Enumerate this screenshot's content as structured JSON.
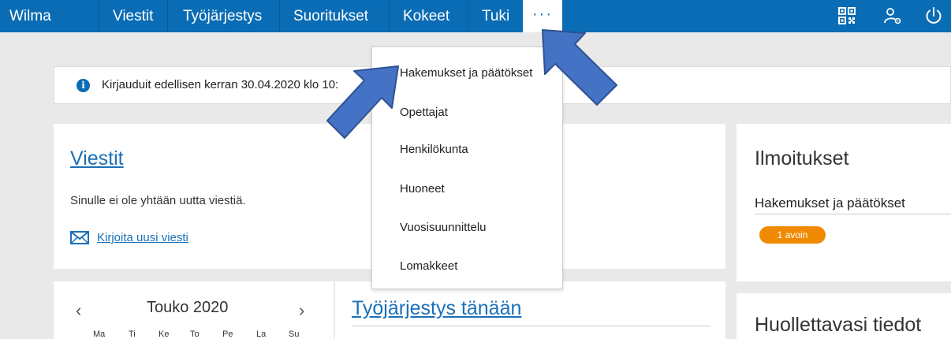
{
  "nav": {
    "brand": "Wilma",
    "items": [
      {
        "label": "Viestit"
      },
      {
        "label": "Työjärjestys"
      },
      {
        "label": "Suoritukset"
      },
      {
        "label": "Kokeet"
      },
      {
        "label": "Tuki"
      }
    ],
    "more_label": "···",
    "icons": [
      "qr-code-icon",
      "user-settings-icon",
      "power-icon"
    ]
  },
  "notice": {
    "text": "Kirjauduit edellisen kerran 30.04.2020 klo 10:"
  },
  "dropdown": {
    "items": [
      {
        "label": "Hakemukset ja päätökset"
      },
      {
        "label": "Opettajat"
      },
      {
        "label": "Henkilökunta"
      },
      {
        "label": "Huoneet"
      },
      {
        "label": "Vuosisuunnittelu"
      },
      {
        "label": "Lomakkeet"
      }
    ]
  },
  "viestit": {
    "title": "Viestit",
    "empty_text": "Sinulle ei ole yhtään uutta viestiä.",
    "new_message": "Kirjoita uusi viesti"
  },
  "ilmoitukset": {
    "title": "Ilmoitukset",
    "item": "Hakemukset ja päätökset",
    "badge": "1 avoin"
  },
  "calendar": {
    "month": "Touko 2020",
    "prev": "‹",
    "next": "›",
    "weekdays": [
      "Ma",
      "Ti",
      "Ke",
      "To",
      "Pe",
      "La",
      "Su"
    ]
  },
  "tyojarjestys": {
    "title": "Työjärjestys tänään"
  },
  "huollettava": {
    "title": "Huollettavasi tiedot"
  },
  "colors": {
    "brand_blue": "#0a6cb4",
    "badge_orange": "#ef8a00",
    "arrow_fill": "#4472c4",
    "arrow_stroke": "#2f528f"
  }
}
